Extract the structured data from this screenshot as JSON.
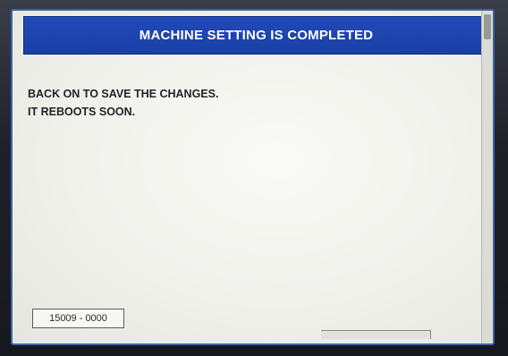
{
  "dialog": {
    "title": "MACHINE SETTING IS COMPLETED",
    "message_lines": [
      "BACK ON TO SAVE THE CHANGES.",
      "IT REBOOTS SOON."
    ],
    "code": "15009 - 0000"
  },
  "colors": {
    "title_bar": "#1a3fa6",
    "title_text": "#ffffff",
    "screen_background": "#f4f4f0",
    "message_text": "#22232a"
  }
}
